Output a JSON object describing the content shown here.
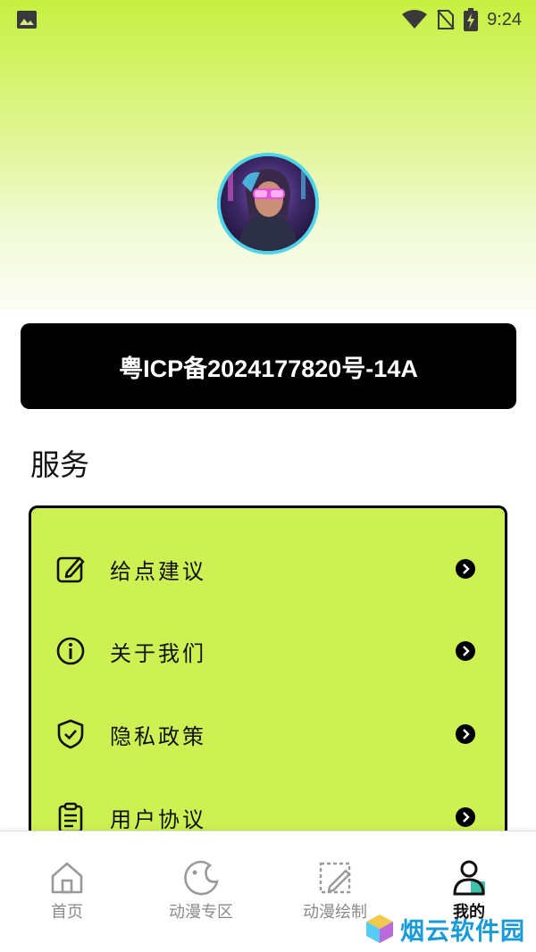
{
  "status_bar": {
    "time": "9:24"
  },
  "icp": {
    "text": "粤ICP备2024177820号-14A"
  },
  "services": {
    "title": "服务",
    "items": [
      {
        "label": "给点建议",
        "icon": "edit-icon"
      },
      {
        "label": "关于我们",
        "icon": "info-icon"
      },
      {
        "label": "隐私政策",
        "icon": "shield-check-icon"
      },
      {
        "label": "用户协议",
        "icon": "clipboard-list-icon"
      }
    ]
  },
  "bottom_nav": {
    "items": [
      {
        "label": "首页",
        "icon": "home-icon"
      },
      {
        "label": "动漫专区",
        "icon": "palette-icon"
      },
      {
        "label": "动漫绘制",
        "icon": "draw-icon"
      },
      {
        "label": "我的",
        "icon": "user-icon",
        "active": true
      }
    ]
  },
  "watermark": {
    "text": "烟云软件园"
  },
  "colors": {
    "accent": "#cdf153",
    "dark": "#000000",
    "avatar_ring": "#4fd3e8"
  }
}
